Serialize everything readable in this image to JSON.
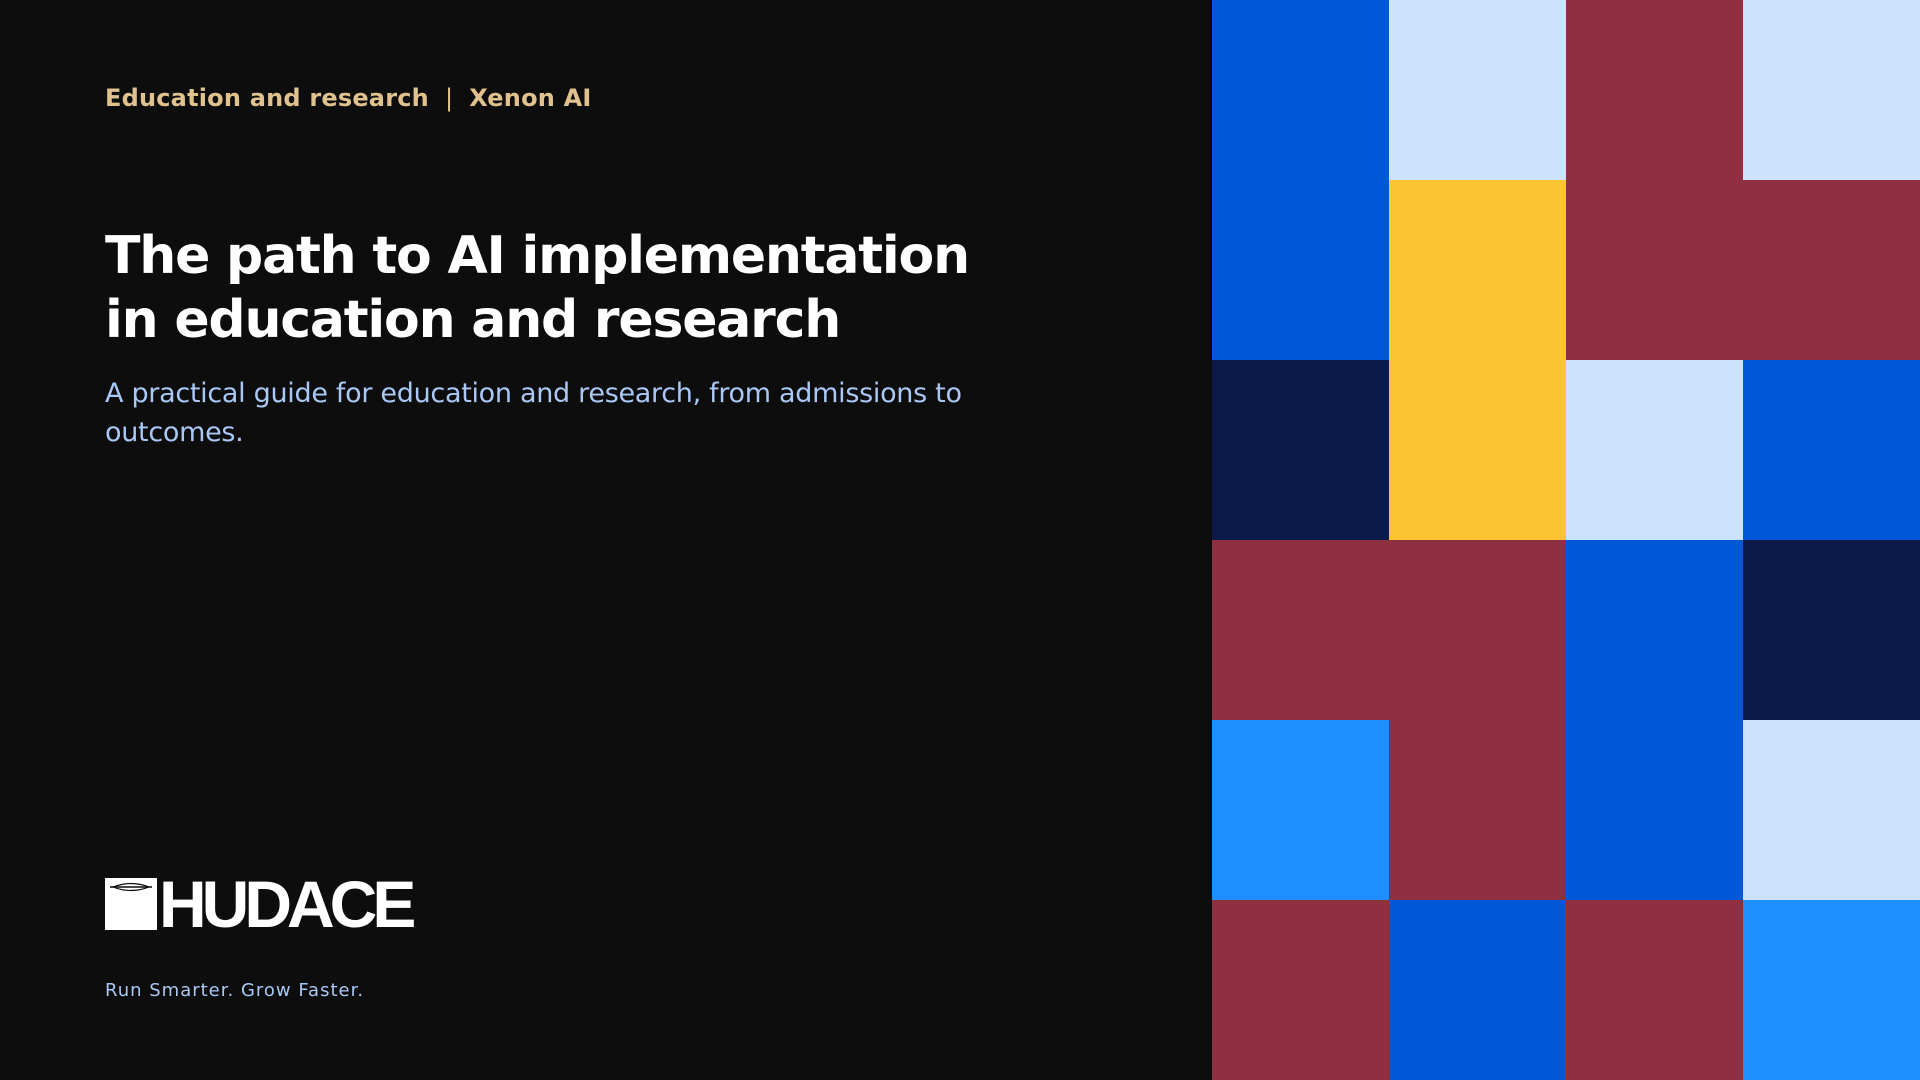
{
  "header": {
    "category": "Education and research",
    "separator": "|",
    "partner": "Xenon AI"
  },
  "title": "The path to AI implementation in education and research",
  "subtitle": "A practical guide for education and research, from admissions to outcomes.",
  "brand": {
    "wordmark": "HUDACE",
    "tagline": "Run Smarter. Grow Faster."
  },
  "colors": {
    "background": "#0d0d0d",
    "accent_gold": "#e0c28e",
    "subtitle_blue": "#a9c8f5",
    "royal_blue": "#0058d6",
    "pale_blue": "#cde3fc",
    "maroon": "#8e3040",
    "yellow": "#fdc533",
    "navy": "#0b1a4a",
    "bright_blue": "#1e8ffe"
  },
  "mosaic": [
    [
      "royal_blue",
      "pale_blue",
      "maroon",
      "pale_blue"
    ],
    [
      "royal_blue",
      "yellow",
      "maroon",
      "maroon"
    ],
    [
      "navy",
      "yellow",
      "pale_blue",
      "royal_blue"
    ],
    [
      "maroon",
      "maroon",
      "royal_blue",
      "navy"
    ],
    [
      "bright_blue",
      "maroon",
      "royal_blue",
      "pale_blue"
    ],
    [
      "maroon",
      "royal_blue",
      "maroon",
      "bright_blue"
    ]
  ]
}
